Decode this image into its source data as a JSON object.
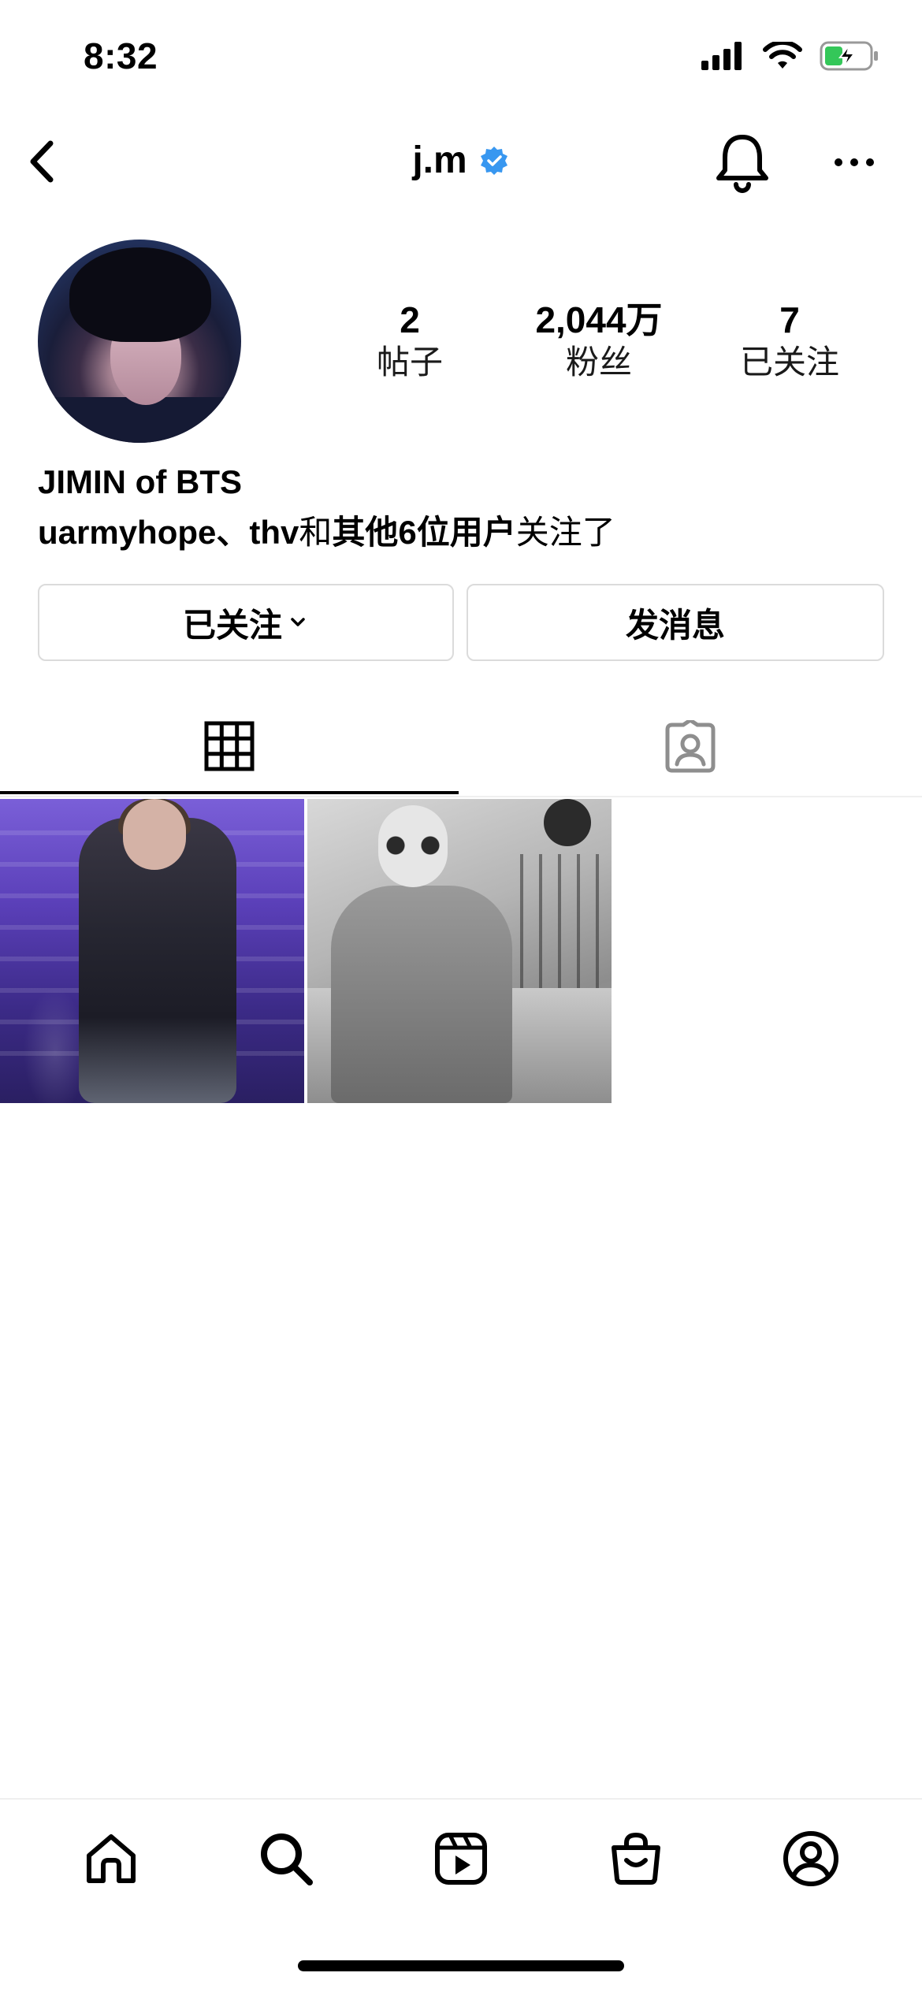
{
  "status_bar": {
    "time": "8:32"
  },
  "nav": {
    "username": "j.m"
  },
  "profile": {
    "stats": [
      {
        "value": "2",
        "label": "帖子"
      },
      {
        "value": "2,044万",
        "label": "粉丝"
      },
      {
        "value": "7",
        "label": "已关注"
      }
    ],
    "name": "JIMIN of BTS",
    "followed_by": {
      "users": "uarmyhope、thv",
      "and": "和",
      "others": "其他6位用户",
      "suffix": "关注了"
    }
  },
  "buttons": {
    "following": "已关注",
    "message": "发消息"
  },
  "colors": {
    "verified": "#3897f0",
    "border": "#dbdbdb",
    "tab_active": "#000000",
    "tab_inactive": "#8e8e8e"
  },
  "icons": {
    "nav": [
      "back-icon",
      "verified-badge-icon",
      "bell-icon",
      "more-icon"
    ],
    "tabs": [
      "grid-icon",
      "tagged-icon"
    ],
    "tabbar": [
      "home-icon",
      "search-icon",
      "reels-icon",
      "shop-icon",
      "profile-icon"
    ]
  }
}
